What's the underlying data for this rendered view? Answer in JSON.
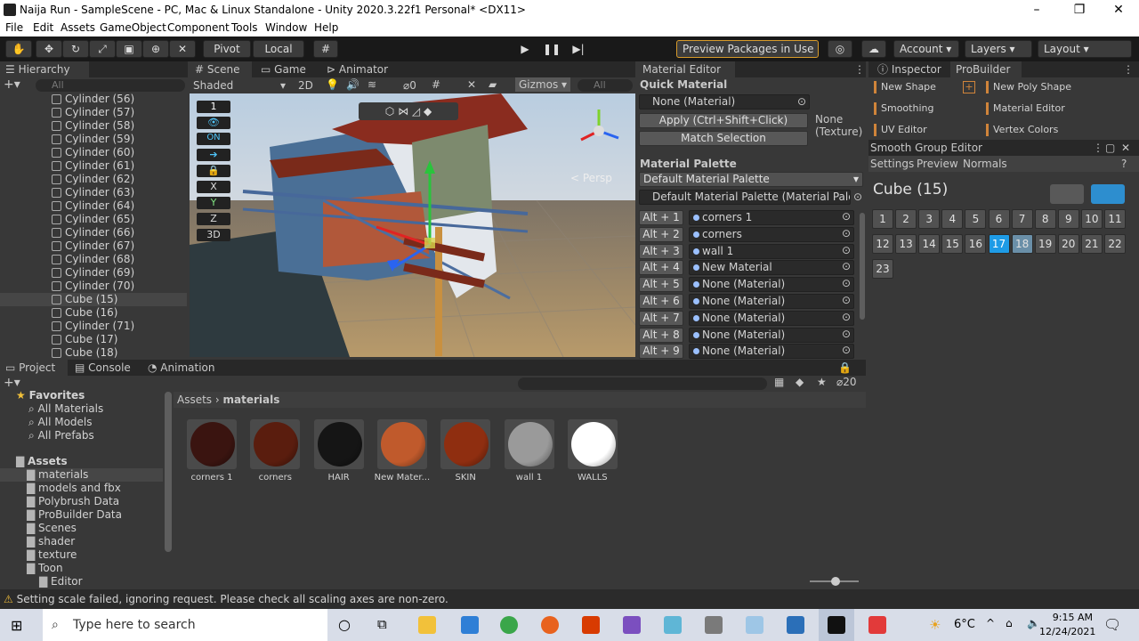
{
  "window": {
    "title": "Naija Run - SampleScene - PC, Mac & Linux Standalone - Unity 2020.3.22f1 Personal* <DX11>"
  },
  "menu": [
    "File",
    "Edit",
    "Assets",
    "GameObject",
    "Component",
    "Tools",
    "Window",
    "Help"
  ],
  "toolbar": {
    "pivot": "Pivot",
    "local": "Local",
    "preview": "Preview Packages in Use",
    "account": "Account",
    "layers": "Layers",
    "layout": "Layout"
  },
  "hierarchy": {
    "tab": "Hierarchy",
    "search": "All",
    "items": [
      "Cylinder (56)",
      "Cylinder (57)",
      "Cylinder (58)",
      "Cylinder (59)",
      "Cylinder (60)",
      "Cylinder (61)",
      "Cylinder (62)",
      "Cylinder (63)",
      "Cylinder (64)",
      "Cylinder (65)",
      "Cylinder (66)",
      "Cylinder (67)",
      "Cylinder (68)",
      "Cylinder (69)",
      "Cylinder (70)",
      "Cube (15)",
      "Cube (16)",
      "Cylinder (71)",
      "Cube (17)",
      "Cube (18)"
    ],
    "selected_index": 15
  },
  "scene": {
    "tabs": [
      "Scene",
      "Game",
      "Animator"
    ],
    "shading": "Shaded",
    "mode2d": "2D",
    "gizmos": "Gizmos",
    "search": "All",
    "persp": "Persp",
    "hidden_count": "0",
    "overlay": [
      "1",
      "ON",
      "X",
      "Y",
      "Z",
      "3D"
    ]
  },
  "material_editor": {
    "tab": "Material Editor",
    "quick_title": "Quick Material",
    "quick_field": "None (Material)",
    "apply": "Apply (Ctrl+Shift+Click)",
    "match": "Match Selection",
    "texture_none": "None",
    "texture_label": "(Texture)",
    "palette_title": "Material Palette",
    "palette_dropdown": "Default Material Palette",
    "palette_field": "Default Material Palette (Material Palette)",
    "rows": [
      {
        "key": "Alt + 1",
        "mat": "corners 1"
      },
      {
        "key": "Alt + 2",
        "mat": "corners"
      },
      {
        "key": "Alt + 3",
        "mat": "wall 1"
      },
      {
        "key": "Alt + 4",
        "mat": "New Material"
      },
      {
        "key": "Alt + 5",
        "mat": "None (Material)"
      },
      {
        "key": "Alt + 6",
        "mat": "None (Material)"
      },
      {
        "key": "Alt + 7",
        "mat": "None (Material)"
      },
      {
        "key": "Alt + 8",
        "mat": "None (Material)"
      },
      {
        "key": "Alt + 9",
        "mat": "None (Material)"
      }
    ]
  },
  "inspector": {
    "tab": "Inspector",
    "probuilder_tab": "ProBuilder",
    "items_left": [
      "New Shape",
      "Smoothing",
      "UV Editor"
    ],
    "items_right": [
      "New Poly Shape",
      "Material Editor",
      "Vertex Colors"
    ],
    "add": "+"
  },
  "smooth": {
    "title": "Smooth Group Editor",
    "tabs": [
      "Settings",
      "Preview",
      "Normals"
    ],
    "object": "Cube (15)",
    "groups": [
      "1",
      "2",
      "3",
      "4",
      "5",
      "6",
      "7",
      "8",
      "9",
      "10",
      "11",
      "12",
      "13",
      "14",
      "15",
      "16",
      "17",
      "18",
      "19",
      "20",
      "21",
      "22",
      "23"
    ],
    "selected": "17",
    "highlight": "18"
  },
  "project": {
    "tabs": [
      "Project",
      "Console",
      "Animation"
    ],
    "count": "20",
    "favorites": "Favorites",
    "fav_items": [
      "All Materials",
      "All Models",
      "All Prefabs"
    ],
    "assets": "Assets",
    "folders": [
      "materials",
      "models and fbx",
      "Polybrush Data",
      "ProBuilder Data",
      "Scenes",
      "shader",
      "texture",
      "Toon",
      "Editor"
    ],
    "breadcrumb": [
      "Assets",
      "materials"
    ],
    "materials": [
      {
        "name": "corners 1",
        "color": "#3a1410"
      },
      {
        "name": "corners",
        "color": "#5a1d0e"
      },
      {
        "name": "HAIR",
        "color": "#151515"
      },
      {
        "name": "New Mater...",
        "color": "#c05a2c"
      },
      {
        "name": "SKIN",
        "color": "#8f2e10"
      },
      {
        "name": "wall 1",
        "color": "#9a9a9a"
      },
      {
        "name": "WALLS",
        "color": "#ffffff"
      }
    ]
  },
  "status": {
    "text": "Setting scale failed, ignoring request. Please check all scaling axes are non-zero."
  },
  "taskbar": {
    "search": "Type here to search",
    "temp": "6°C",
    "time": "9:15 AM",
    "date": "12/24/2021"
  }
}
